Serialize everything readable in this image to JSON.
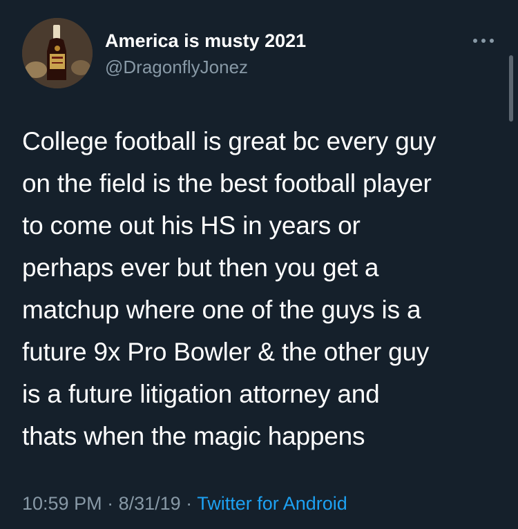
{
  "author": {
    "display_name": "America is musty 2021",
    "handle": "@DragonflyJonez",
    "avatar_icon": "liquor-bottle-avatar"
  },
  "tweet": {
    "text": "College football is great bc every guy\non the field is the best football player\nto come out his HS in years or\nperhaps ever but then you get a\nmatchup where one of the guys is a\nfuture 9x Pro Bowler & the other guy\nis a future litigation attorney and\nthats when the magic happens"
  },
  "meta": {
    "time": "10:59 PM",
    "separator1": " · ",
    "date": "8/31/19",
    "separator2": " · ",
    "source": "Twitter for Android"
  },
  "colors": {
    "background": "#15202b",
    "secondary_text": "#8899a6",
    "link": "#1da1f2"
  }
}
